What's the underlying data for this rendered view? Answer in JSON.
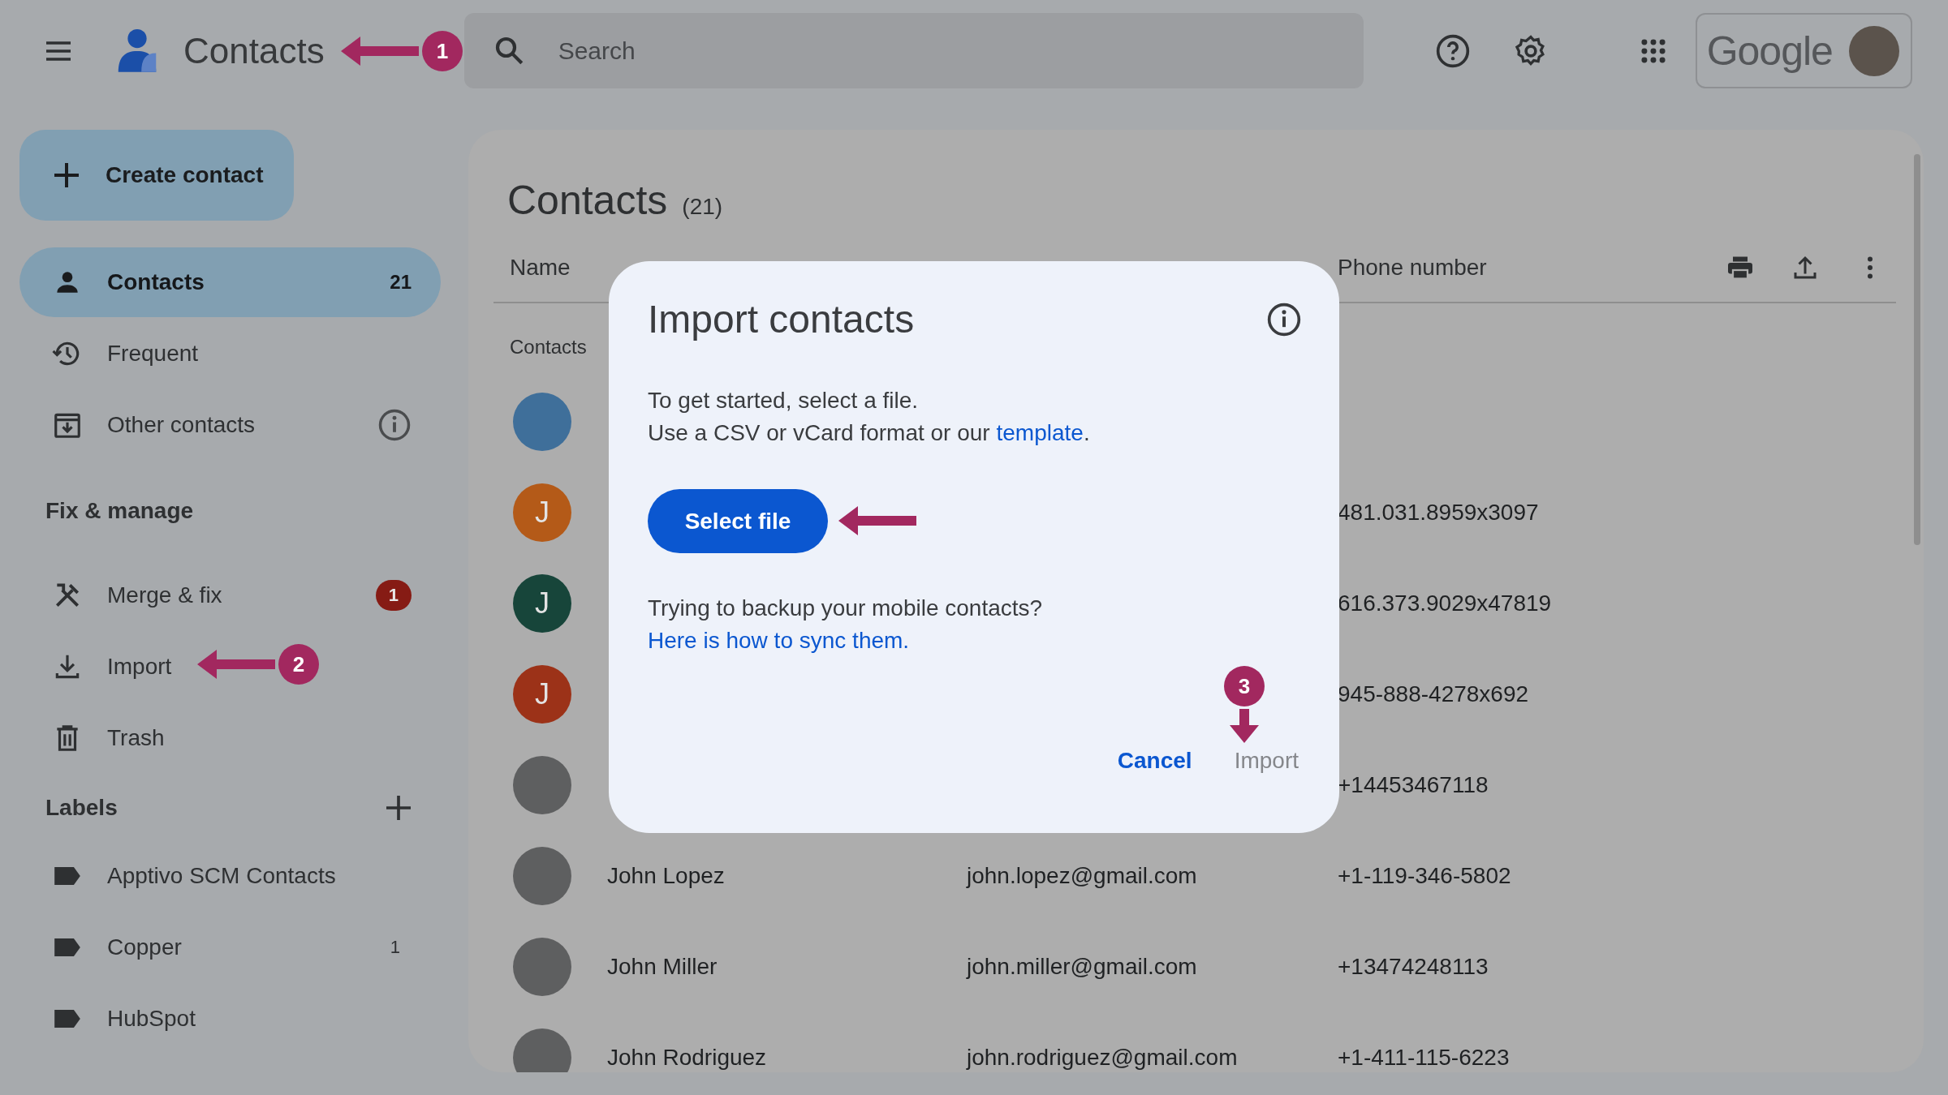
{
  "header": {
    "app_name": "Contacts",
    "search": {
      "placeholder": "Search"
    },
    "account": {
      "brand": "Google"
    }
  },
  "sidebar": {
    "create_button": "Create contact",
    "nav": [
      {
        "label": "Contacts",
        "count": "21",
        "selected": true
      },
      {
        "label": "Frequent",
        "selected": false
      },
      {
        "label": "Other contacts",
        "info": true,
        "selected": false
      }
    ],
    "fix_section": {
      "title": "Fix & manage",
      "items": [
        {
          "label": "Merge & fix",
          "badge": "1",
          "selected": false
        },
        {
          "label": "Import",
          "selected": false
        },
        {
          "label": "Trash",
          "selected": false
        }
      ]
    },
    "labels": {
      "title": "Labels",
      "items": [
        {
          "label": "Apptivo SCM Contacts"
        },
        {
          "label": "Copper",
          "count": "1"
        },
        {
          "label": "HubSpot"
        }
      ]
    }
  },
  "main": {
    "title": "Contacts",
    "count": "(21)",
    "column_headers": {
      "name": "Name",
      "phone": "Phone number"
    },
    "section_label": "Contacts",
    "rows": [
      {
        "avatar": {
          "kind": "image"
        }
      },
      {
        "avatar": {
          "kind": "letter",
          "letter": "J",
          "color": "#b45a18"
        },
        "phone": "481.031.8959x3097"
      },
      {
        "avatar": {
          "kind": "letter",
          "letter": "J",
          "color": "#17453a"
        },
        "phone": "616.373.9029x47819"
      },
      {
        "avatar": {
          "kind": "letter",
          "letter": "J",
          "color": "#9c3218"
        },
        "phone": "945-888-4278x692"
      },
      {
        "avatar": {
          "kind": "photo"
        },
        "phone": "+14453467118"
      },
      {
        "avatar": {
          "kind": "photo"
        },
        "name": "John Lopez",
        "email": "john.lopez@gmail.com",
        "phone": "+1-119-346-5802"
      },
      {
        "avatar": {
          "kind": "photo"
        },
        "name": "John Miller",
        "email": "john.miller@gmail.com",
        "phone": "+13474248113"
      },
      {
        "avatar": {
          "kind": "photo"
        },
        "name": "John Rodriguez",
        "email": "john.rodriguez@gmail.com",
        "phone": "+1-411-115-6223"
      }
    ]
  },
  "dialog": {
    "title": "Import contacts",
    "lines": [
      {
        "text": "To get started, select a file."
      },
      {
        "text": "Use a CSV or vCard format or our ",
        "link": "template",
        "after": "."
      }
    ],
    "select_button": "Select file",
    "sync": {
      "text": "Trying to backup your mobile contacts? ",
      "link": "Here is how to sync them."
    },
    "buttons": [
      {
        "label": "Cancel",
        "disabled": false
      },
      {
        "label": "Import",
        "disabled": true
      }
    ]
  },
  "annotations": [
    {
      "number": "1"
    },
    {
      "number": "2"
    },
    {
      "number": "3"
    }
  ]
}
